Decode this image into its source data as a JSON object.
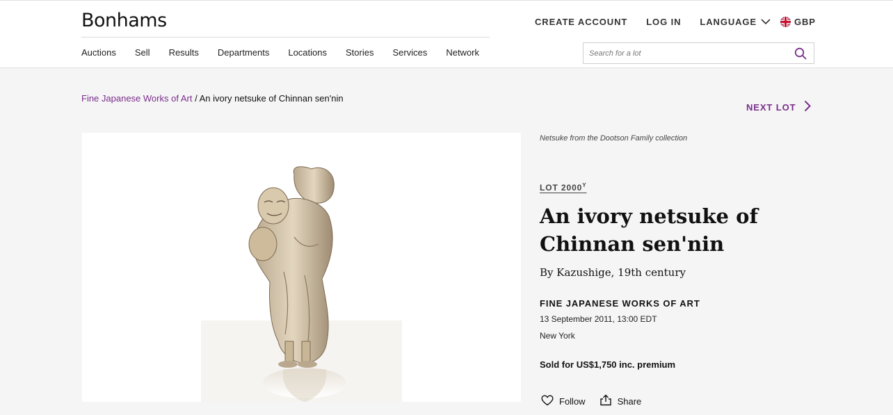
{
  "brand": {
    "logo_text": "Bonhams",
    "accent": "#7a2d8c"
  },
  "header": {
    "nav": [
      "Auctions",
      "Sell",
      "Results",
      "Departments",
      "Locations",
      "Stories",
      "Services",
      "Network"
    ],
    "create_account": "CREATE ACCOUNT",
    "log_in": "LOG IN",
    "language": "LANGUAGE",
    "currency": "GBP",
    "search_placeholder": "Search for a lot"
  },
  "breadcrumb": {
    "parent": "Fine Japanese Works of Art",
    "separator": " / ",
    "current": "An ivory netsuke of Chinnan sen'nin"
  },
  "next_lot": "NEXT LOT",
  "lot": {
    "collection": "Netsuke from the Dootson Family collection",
    "lot_label": "LOT 2000",
    "lot_symbol": "Y",
    "title": "An ivory netsuke of Chinnan sen'nin",
    "subtitle": "By Kazushige, 19th century",
    "sale_name": "FINE JAPANESE WORKS OF ART",
    "sale_date": "13 September 2011, 13:00 EDT",
    "sale_location": "New York",
    "sold_text": "Sold for US$1,750 inc. premium"
  },
  "actions": {
    "follow": "Follow",
    "share": "Share"
  },
  "icons": [
    "search-icon",
    "chevron-down-icon",
    "uk-flag-icon",
    "chevron-right-icon",
    "heart-icon",
    "share-icon"
  ]
}
